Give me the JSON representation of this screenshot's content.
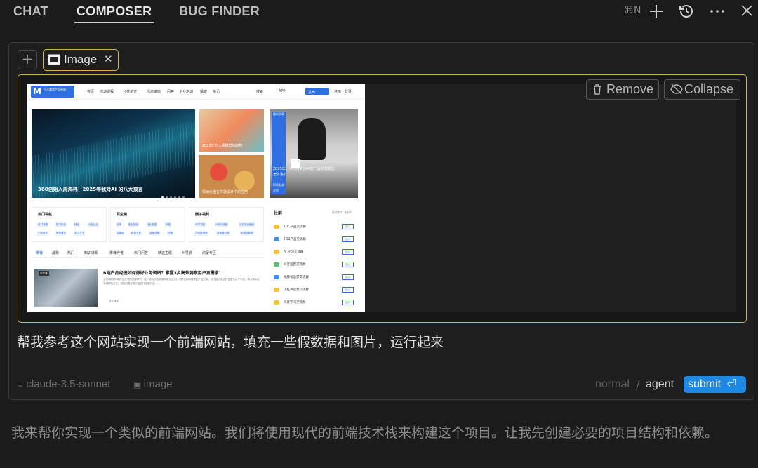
{
  "topbar": {
    "tabs": [
      "CHAT",
      "COMPOSER",
      "BUG FINDER"
    ],
    "active_tab": "COMPOSER",
    "new_shortcut": "⌘N"
  },
  "composer": {
    "attachment": {
      "label": "Image"
    },
    "preview": {
      "remove_label": "Remove",
      "collapse_label": "Collapse"
    },
    "prompt_text": "帮我参考这个网站实现一个前端网站，填充一些假数据和图片，运行起来",
    "model": "claude-3.5-sonnet",
    "context_tag": "image",
    "mode_options": [
      "normal",
      "agent"
    ],
    "active_mode": "agent",
    "submit_label": "submit"
  },
  "site": {
    "logo_text": "人人都是产品经理",
    "logo_url": "woshipm.com",
    "nav": [
      "首页",
      "培训课程",
      "分类浏览",
      "活动讲座",
      "问答",
      "企业培训",
      "播客",
      "快讯"
    ],
    "nav_right": [
      "搜索",
      "APP",
      "发布",
      "注册 | 登录"
    ],
    "banner_caption": "360创始人周鸿祎：2025年我对AI 的八大预言",
    "tiles": [
      {
        "caption": "2025年五大关键营销趋势"
      },
      {
        "caption": "情绪价值在体验设计中的应用"
      }
    ],
    "feature": {
      "tag": "最新文章",
      "caption": "2025年，平均月薪24K的产品经理岗位，怎么进？",
      "author": "职场起来",
      "source": "全国"
    },
    "cards": [
      {
        "title": "热门导航",
        "pills": [
          "热门专题",
          "热门作者",
          "转社",
          "行业论坛",
          "产品设计",
          "职场成长",
          "学习方法",
          "新手入门"
        ]
      },
      {
        "title": "百宝箱",
        "pills": [
          "书单",
          "职业规划",
          "行业图谱",
          "作图",
          "AI课堂",
          "每日头条",
          "运营攻略",
          "热榜"
        ]
      },
      {
        "title": "圈子福利",
        "pills": [
          "AI学习圈",
          "AI新产品圈",
          "小红书运营圈",
          "产品经理圈",
          "运营增长圈",
          "私域运营圈"
        ]
      }
    ],
    "content_tabs": [
      "推荐",
      "最新",
      "热门",
      "知识体系",
      "推荐作者",
      "热门问答",
      "精选主题",
      "AI导航",
      "鸿蒙专区"
    ],
    "article": {
      "badge": "公开课",
      "title": "B端产品经理如何做好业务调研？掌握3步高效洞察用户真需求！",
      "body": "业务调研是B端产品立项的关键环节，缺少实际的业务调研就无法设计出符合实际需求的产品方案，对于新人来说往往是无从下手的。本文将从业务调研的方法、流程和要点等方面进行详细介绍……",
      "author": "起点课堂"
    },
    "side": {
      "title": "社群",
      "more": "找群看群 | 更多群",
      "rows": [
        "TOC产品交流群",
        "TOB产品交流群",
        "AI 学习交流群",
        "抖音运营交流群",
        "视频号运营交流群",
        "小红书运营交流群",
        "鸿蒙学习交流群"
      ],
      "join_label": "加入"
    }
  },
  "reply_text": "我来帮你实现一个类似的前端网站。我们将使用现代的前端技术栈来构建这个项目。让我先创建必要的项目结构和依赖。",
  "colors": {
    "background": "#1b1b1c",
    "accent": "#d8b24a",
    "submit": "#1e88e5",
    "site_blue": "#2f6fe0"
  }
}
